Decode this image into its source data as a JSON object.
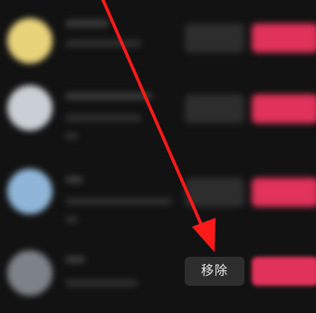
{
  "list": {
    "rows": [
      {
        "avatar_color": "#e8d27a"
      },
      {
        "avatar_color": "#c9cfd4"
      },
      {
        "avatar_color": "#8fb6d8"
      },
      {
        "avatar_color": "#7d8288"
      }
    ]
  },
  "action": {
    "remove_label": "移除"
  },
  "colors": {
    "accent_red": "#e0325a",
    "arrow_red": "#ff1a1a",
    "background": "#121212"
  },
  "annotation": {
    "icon": "red-arrow"
  }
}
